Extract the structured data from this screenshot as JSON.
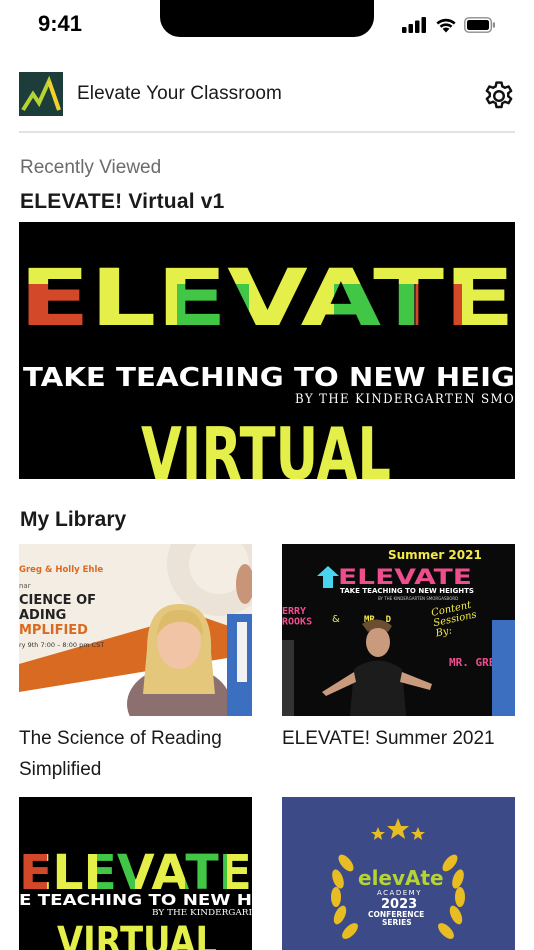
{
  "status": {
    "time": "9:41"
  },
  "header": {
    "title": "Elevate Your Classroom"
  },
  "recent": {
    "label": "Recently Viewed",
    "title": "ELEVATE! Virtual v1",
    "thumb": {
      "headline": "ELEVATE",
      "tagline": "TAKE TEACHING TO NEW HEIG",
      "byline": "BY THE KINDERGARTEN SMO",
      "word": "VIRTUAL"
    }
  },
  "library": {
    "label": "My Library",
    "items": [
      {
        "title": "The Science of Reading Simplified",
        "thumb": {
          "presenters": "Greg & Holly Ehle",
          "line0": "nar",
          "line1": "CIENCE OF",
          "line2": "ADING",
          "line3": "MPLIFIED",
          "date": "ry 9th    7:00 – 8:00 pm CST"
        }
      },
      {
        "title": "ELEVATE! Summer 2021",
        "thumb": {
          "season": "Summer 2021",
          "headline": "ELEVATE",
          "tagline": "TAKE TEACHING TO NEW HEIGHTS",
          "byline": "BY THE KINDERGARTEN SMORGASBORD",
          "left_names": "ERRY\nROOKS",
          "amp": "&",
          "mr_d": "MR. D",
          "script": "Content\nSessions\nBy:",
          "mr_greg": "MR. GREG"
        }
      },
      {
        "title": "",
        "thumb": {
          "headline": "ELEVATE",
          "tagline": "E TEACHING TO NEW H",
          "byline": "BY THE KINDERGARI",
          "word": "VIRTUAL"
        }
      },
      {
        "title": "",
        "thumb": {
          "brand": "elevAte",
          "sub": "ACADEMY",
          "year": "2023",
          "series1": "CONFERENCE",
          "series2": "SERIES"
        }
      }
    ]
  },
  "colors": {
    "pink": "#ee4d8e",
    "cyan": "#48d4ef",
    "yellow": "#e4ef4a",
    "navy": "#3c4a87",
    "gold": "#e7bd23",
    "orange": "#d96a21"
  },
  "icons": [
    "signal-icon",
    "wifi-icon",
    "battery-icon",
    "gear-icon"
  ]
}
